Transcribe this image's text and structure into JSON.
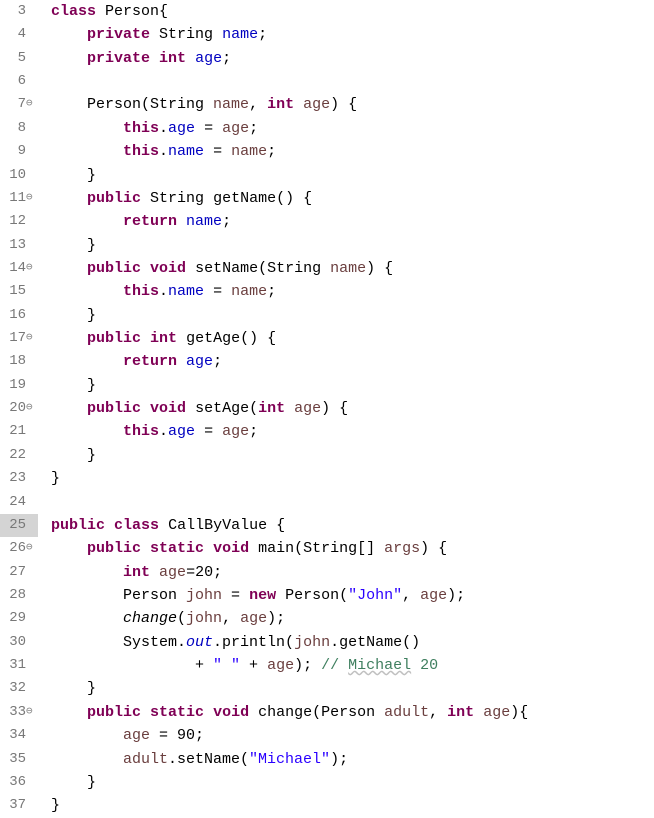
{
  "lines": [
    {
      "num": "3",
      "marker": "",
      "tokens": [
        [
          "kw",
          "class"
        ],
        [
          "",
          null,
          " "
        ],
        [
          "type",
          "Person"
        ],
        [
          "",
          "{"
        ]
      ]
    },
    {
      "num": "4",
      "marker": "",
      "tokens": [
        [
          "",
          "    "
        ],
        [
          "kw",
          "private"
        ],
        [
          "",
          " "
        ],
        [
          "type",
          "String"
        ],
        [
          "",
          " "
        ],
        [
          "field",
          "name"
        ],
        [
          "",
          ";"
        ]
      ]
    },
    {
      "num": "5",
      "marker": "",
      "tokens": [
        [
          "",
          "    "
        ],
        [
          "kw",
          "private"
        ],
        [
          "",
          " "
        ],
        [
          "kw",
          "int"
        ],
        [
          "",
          " "
        ],
        [
          "field",
          "age"
        ],
        [
          "",
          ";"
        ]
      ]
    },
    {
      "num": "6",
      "marker": "",
      "tokens": [
        [
          "",
          ""
        ]
      ]
    },
    {
      "num": "7",
      "marker": "⊖",
      "tokens": [
        [
          "",
          "    "
        ],
        [
          "type",
          "Person"
        ],
        [
          "",
          "(String "
        ],
        [
          "var",
          "name"
        ],
        [
          "",
          ", "
        ],
        [
          "kw",
          "int"
        ],
        [
          "",
          " "
        ],
        [
          "var",
          "age"
        ],
        [
          "",
          ") {"
        ]
      ]
    },
    {
      "num": "8",
      "marker": "",
      "tokens": [
        [
          "",
          "        "
        ],
        [
          "kw",
          "this"
        ],
        [
          "",
          "."
        ],
        [
          "field",
          "age"
        ],
        [
          "",
          " = "
        ],
        [
          "var",
          "age"
        ],
        [
          "",
          ";"
        ]
      ]
    },
    {
      "num": "9",
      "marker": "",
      "tokens": [
        [
          "",
          "        "
        ],
        [
          "kw",
          "this"
        ],
        [
          "",
          "."
        ],
        [
          "field",
          "name"
        ],
        [
          "",
          " = "
        ],
        [
          "var",
          "name"
        ],
        [
          "",
          ";"
        ]
      ]
    },
    {
      "num": "10",
      "marker": "",
      "tokens": [
        [
          "",
          "    }"
        ]
      ]
    },
    {
      "num": "11",
      "marker": "⊖",
      "tokens": [
        [
          "",
          "    "
        ],
        [
          "kw",
          "public"
        ],
        [
          "",
          " "
        ],
        [
          "type",
          "String"
        ],
        [
          "",
          " "
        ],
        [
          "method",
          "getName"
        ],
        [
          "",
          "() {"
        ]
      ]
    },
    {
      "num": "12",
      "marker": "",
      "tokens": [
        [
          "",
          "        "
        ],
        [
          "kw",
          "return"
        ],
        [
          "",
          " "
        ],
        [
          "field",
          "name"
        ],
        [
          "",
          ";"
        ]
      ]
    },
    {
      "num": "13",
      "marker": "",
      "tokens": [
        [
          "",
          "    }"
        ]
      ]
    },
    {
      "num": "14",
      "marker": "⊖",
      "tokens": [
        [
          "",
          "    "
        ],
        [
          "kw",
          "public"
        ],
        [
          "",
          " "
        ],
        [
          "kw",
          "void"
        ],
        [
          "",
          " "
        ],
        [
          "method",
          "setName"
        ],
        [
          "",
          "(String "
        ],
        [
          "var",
          "name"
        ],
        [
          "",
          ") {"
        ]
      ]
    },
    {
      "num": "15",
      "marker": "",
      "tokens": [
        [
          "",
          "        "
        ],
        [
          "kw",
          "this"
        ],
        [
          "",
          "."
        ],
        [
          "field",
          "name"
        ],
        [
          "",
          " = "
        ],
        [
          "var",
          "name"
        ],
        [
          "",
          ";"
        ]
      ]
    },
    {
      "num": "16",
      "marker": "",
      "tokens": [
        [
          "",
          "    }"
        ]
      ]
    },
    {
      "num": "17",
      "marker": "⊖",
      "tokens": [
        [
          "",
          "    "
        ],
        [
          "kw",
          "public"
        ],
        [
          "",
          " "
        ],
        [
          "kw",
          "int"
        ],
        [
          "",
          " "
        ],
        [
          "method",
          "getAge"
        ],
        [
          "",
          "() {"
        ]
      ]
    },
    {
      "num": "18",
      "marker": "",
      "tokens": [
        [
          "",
          "        "
        ],
        [
          "kw",
          "return"
        ],
        [
          "",
          " "
        ],
        [
          "field",
          "age"
        ],
        [
          "",
          ";"
        ]
      ]
    },
    {
      "num": "19",
      "marker": "",
      "tokens": [
        [
          "",
          "    }"
        ]
      ]
    },
    {
      "num": "20",
      "marker": "⊖",
      "tokens": [
        [
          "",
          "    "
        ],
        [
          "kw",
          "public"
        ],
        [
          "",
          " "
        ],
        [
          "kw",
          "void"
        ],
        [
          "",
          " "
        ],
        [
          "method",
          "setAge"
        ],
        [
          "",
          "("
        ],
        [
          "kw",
          "int"
        ],
        [
          "",
          " "
        ],
        [
          "var",
          "age"
        ],
        [
          "",
          ") {"
        ]
      ]
    },
    {
      "num": "21",
      "marker": "",
      "tokens": [
        [
          "",
          "        "
        ],
        [
          "kw",
          "this"
        ],
        [
          "",
          "."
        ],
        [
          "field",
          "age"
        ],
        [
          "",
          " = "
        ],
        [
          "var",
          "age"
        ],
        [
          "",
          ";"
        ]
      ]
    },
    {
      "num": "22",
      "marker": "",
      "tokens": [
        [
          "",
          "    }"
        ]
      ]
    },
    {
      "num": "23",
      "marker": "",
      "tokens": [
        [
          "",
          "}"
        ]
      ]
    },
    {
      "num": "24",
      "marker": "",
      "tokens": [
        [
          "",
          ""
        ]
      ]
    },
    {
      "num": "25",
      "marker": "",
      "tokens": [
        [
          "kw",
          "public"
        ],
        [
          "",
          " "
        ],
        [
          "kw",
          "class"
        ],
        [
          "",
          " "
        ],
        [
          "type",
          "CallByValue"
        ],
        [
          "",
          " {"
        ]
      ]
    },
    {
      "num": "26",
      "marker": "⊖",
      "tokens": [
        [
          "",
          "    "
        ],
        [
          "kw",
          "public"
        ],
        [
          "",
          " "
        ],
        [
          "kw",
          "static"
        ],
        [
          "",
          " "
        ],
        [
          "kw",
          "void"
        ],
        [
          "",
          " "
        ],
        [
          "method",
          "main"
        ],
        [
          "",
          "(String[] "
        ],
        [
          "var",
          "args"
        ],
        [
          "",
          ") {"
        ]
      ]
    },
    {
      "num": "27",
      "marker": "",
      "tokens": [
        [
          "",
          "        "
        ],
        [
          "kw",
          "int"
        ],
        [
          "",
          " "
        ],
        [
          "var",
          "age"
        ],
        [
          "",
          "=20;"
        ]
      ]
    },
    {
      "num": "28",
      "marker": "",
      "tokens": [
        [
          "",
          "        Person "
        ],
        [
          "var",
          "john"
        ],
        [
          "",
          " = "
        ],
        [
          "kw",
          "new"
        ],
        [
          "",
          " Person("
        ],
        [
          "str",
          "\"John\""
        ],
        [
          "",
          ", "
        ],
        [
          "var",
          "age"
        ],
        [
          "",
          ");"
        ]
      ]
    },
    {
      "num": "29",
      "marker": "",
      "tokens": [
        [
          "",
          "        "
        ],
        [
          "italic",
          "change"
        ],
        [
          "",
          "("
        ],
        [
          "var",
          "john"
        ],
        [
          "",
          ", "
        ],
        [
          "var",
          "age"
        ],
        [
          "",
          ");"
        ]
      ]
    },
    {
      "num": "30",
      "marker": "",
      "tokens": [
        [
          "",
          "        System."
        ],
        [
          "static-field",
          "out"
        ],
        [
          "",
          ".println("
        ],
        [
          "var",
          "john"
        ],
        [
          "",
          ".getName()"
        ]
      ]
    },
    {
      "num": "31",
      "marker": "",
      "tokens": [
        [
          "",
          "                + "
        ],
        [
          "str",
          "\" \""
        ],
        [
          "",
          " + "
        ],
        [
          "var",
          "age"
        ],
        [
          "",
          "); "
        ],
        [
          "comment",
          "// "
        ],
        [
          "comment underline-wavy",
          "Michael"
        ],
        [
          "comment",
          " 20"
        ]
      ]
    },
    {
      "num": "32",
      "marker": "",
      "tokens": [
        [
          "",
          "    }"
        ]
      ]
    },
    {
      "num": "33",
      "marker": "⊖",
      "tokens": [
        [
          "",
          "    "
        ],
        [
          "kw",
          "public"
        ],
        [
          "",
          " "
        ],
        [
          "kw",
          "static"
        ],
        [
          "",
          " "
        ],
        [
          "kw",
          "void"
        ],
        [
          "",
          " "
        ],
        [
          "method",
          "change"
        ],
        [
          "",
          "(Person "
        ],
        [
          "var",
          "adult"
        ],
        [
          "",
          ", "
        ],
        [
          "kw",
          "int"
        ],
        [
          "",
          " "
        ],
        [
          "var",
          "age"
        ],
        [
          "",
          "){"
        ]
      ]
    },
    {
      "num": "34",
      "marker": "",
      "tokens": [
        [
          "",
          "        "
        ],
        [
          "var",
          "age"
        ],
        [
          "",
          " = 90;"
        ]
      ]
    },
    {
      "num": "35",
      "marker": "",
      "tokens": [
        [
          "",
          "        "
        ],
        [
          "var",
          "adult"
        ],
        [
          "",
          ".setName("
        ],
        [
          "str",
          "\"Michael\""
        ],
        [
          "",
          ");"
        ]
      ]
    },
    {
      "num": "36",
      "marker": "",
      "tokens": [
        [
          "",
          "    }"
        ]
      ]
    },
    {
      "num": "37",
      "marker": "",
      "tokens": [
        [
          "",
          "}"
        ]
      ]
    }
  ]
}
